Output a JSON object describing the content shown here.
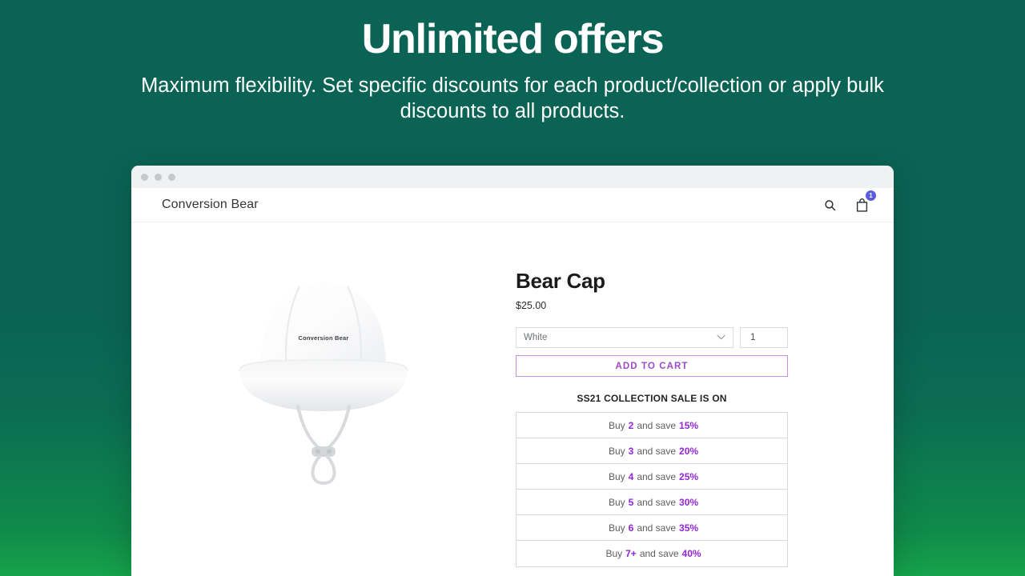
{
  "hero": {
    "title": "Unlimited offers",
    "subtitle": "Maximum flexibility. Set specific discounts for each product/collection or apply bulk discounts to all products."
  },
  "colors": {
    "background_top": "#0a6354",
    "background_bottom": "#16a34a",
    "accent_purple": "#9425d8",
    "cart_badge": "#5c5ce0",
    "button_border": "#c98ce0"
  },
  "browser": {
    "traffic_lights": [
      "window-close",
      "window-minimize",
      "window-maximize"
    ],
    "store_name": "Conversion Bear",
    "icons": {
      "search": "search-icon",
      "cart": "shopping-bag-icon"
    },
    "cart_count": "1"
  },
  "product": {
    "image_brand_text": "Conversion Bear",
    "title": "Bear Cap",
    "price": "$25.00",
    "variant": {
      "selected": "White",
      "caret": "chevron-down-icon"
    },
    "quantity": "1",
    "add_to_cart_label": "ADD TO CART",
    "sale_heading": "SS21 COLLECTION SALE IS ON",
    "tiers": [
      {
        "prefix": "Buy",
        "qty": "2",
        "middle": "and save",
        "discount": "15%"
      },
      {
        "prefix": "Buy",
        "qty": "3",
        "middle": "and save",
        "discount": "20%"
      },
      {
        "prefix": "Buy",
        "qty": "4",
        "middle": "and save",
        "discount": "25%"
      },
      {
        "prefix": "Buy",
        "qty": "5",
        "middle": "and save",
        "discount": "30%"
      },
      {
        "prefix": "Buy",
        "qty": "6",
        "middle": "and save",
        "discount": "35%"
      },
      {
        "prefix": "Buy",
        "qty": "7+",
        "middle": "and save",
        "discount": "40%"
      }
    ]
  }
}
